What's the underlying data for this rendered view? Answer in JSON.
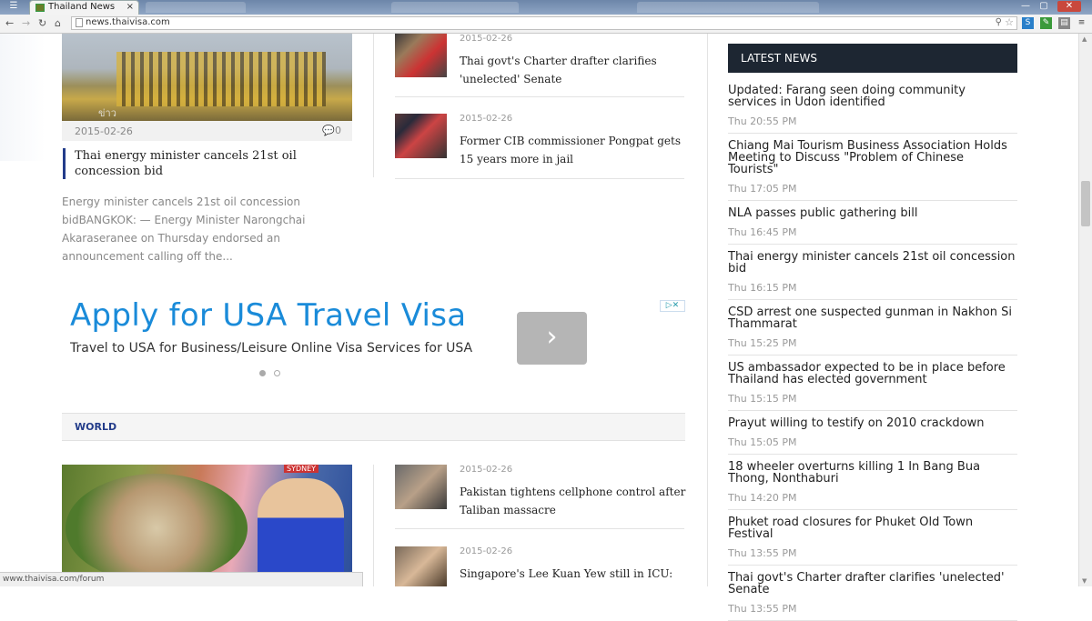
{
  "browser": {
    "tab_title": "Thailand News",
    "tab_close": "×",
    "url": "news.thaivisa.com",
    "status_url": "www.thaivisa.com/forum"
  },
  "icons": [
    "back-icon",
    "forward-icon",
    "reload-icon",
    "page-icon",
    "search-icon",
    "star-icon",
    "menu-icon",
    "next-arrow-icon",
    "comment-icon"
  ],
  "colors": {
    "accent": "#233c8a",
    "header_dark": "#1d2632",
    "ad_blue": "#1a8bd9"
  },
  "main_story": {
    "date": "2015-02-26",
    "comments": "0",
    "headline": "Thai energy minister cancels 21st oil concession bid",
    "excerpt": "Energy minister cancels 21st oil concession bidBANGKOK: — Energy Minister Narongchai Akaraseranee on Thursday endorsed an announcement calling off the..."
  },
  "side_stories": [
    {
      "date": "2015-02-26",
      "title": "Thai govt's Charter drafter clarifies 'unelected' Senate"
    },
    {
      "date": "2015-02-26",
      "title": "Former CIB commissioner Pongpat gets 15 years more in jail"
    }
  ],
  "ad": {
    "headline": "Apply for USA Travel Visa",
    "subline": "Travel to USA for Business/Leisure Online Visa Services for USA",
    "next": "›"
  },
  "world": {
    "label": "WORLD",
    "stories": [
      {
        "date": "2015-02-26",
        "title": "Pakistan tightens cellphone control after Taliban massacre"
      },
      {
        "date": "2015-02-26",
        "title": "Singapore's Lee Kuan Yew still in ICU:"
      }
    ]
  },
  "latest_news": {
    "header": "LATEST NEWS",
    "items": [
      {
        "title": "Updated: Farang seen doing community services in Udon identified",
        "time": "Thu 20:55 PM"
      },
      {
        "title": "Chiang Mai Tourism Business Association Holds Meeting to Discuss \"Problem of Chinese Tourists\"",
        "time": "Thu 17:05 PM"
      },
      {
        "title": "NLA passes public gathering bill",
        "time": "Thu 16:45 PM"
      },
      {
        "title": "Thai energy minister cancels 21st oil concession bid",
        "time": "Thu 16:15 PM"
      },
      {
        "title": "CSD arrest one suspected gunman in Nakhon Si Thammarat",
        "time": "Thu 15:25 PM"
      },
      {
        "title": "US ambassador expected to be in place before Thailand has elected government",
        "time": "Thu 15:15 PM"
      },
      {
        "title": "Prayut willing to testify on 2010 crackdown",
        "time": "Thu 15:05 PM"
      },
      {
        "title": "18 wheeler overturns killing 1 In Bang Bua Thong, Nonthaburi",
        "time": "Thu 14:20 PM"
      },
      {
        "title": "Phuket road closures for Phuket Old Town Festival",
        "time": "Thu 13:55 PM"
      },
      {
        "title": "Thai govt's Charter drafter clarifies 'unelected' Senate",
        "time": "Thu 13:55 PM"
      }
    ]
  }
}
